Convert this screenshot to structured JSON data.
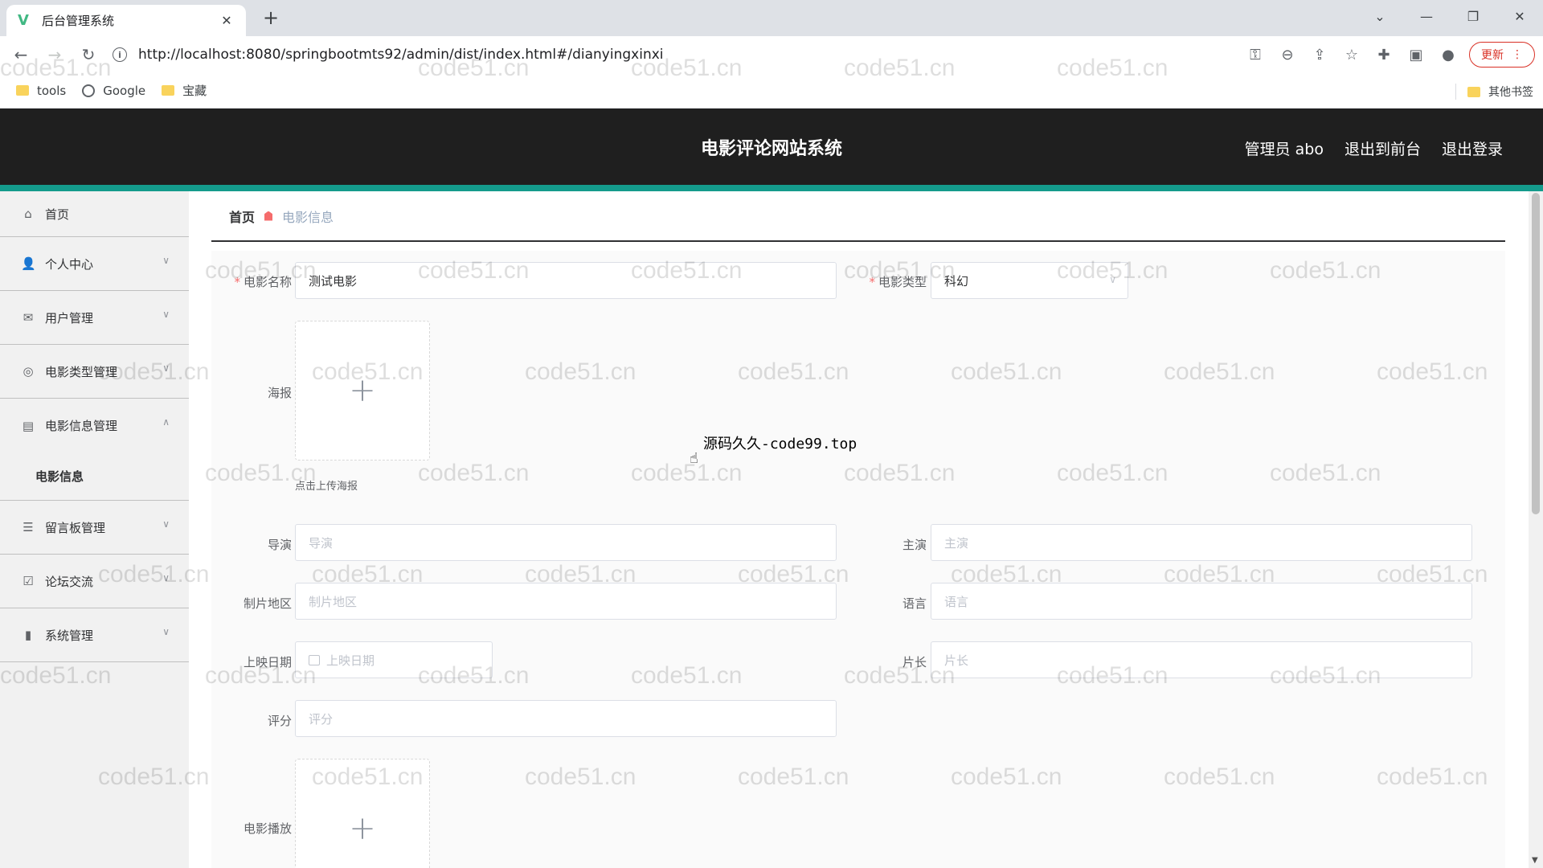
{
  "browser": {
    "tab_title": "后台管理系统",
    "tab_close": "✕",
    "new_tab": "+",
    "url": "http://localhost:8080/springbootmts92/admin/dist/index.html#/dianyingxinxi",
    "update_label": "更新",
    "bookmarks": [
      "tools",
      "Google",
      "宝藏"
    ],
    "other_bookmarks": "其他书签"
  },
  "header": {
    "title": "电影评论网站系统",
    "links": [
      "管理员 abo",
      "退出到前台",
      "退出登录"
    ]
  },
  "sidebar": {
    "items": [
      {
        "label": "首页",
        "icon": "home-icon"
      },
      {
        "label": "个人中心",
        "icon": "user-icon"
      },
      {
        "label": "用户管理",
        "icon": "mail-icon"
      },
      {
        "label": "电影类型管理",
        "icon": "target-icon"
      },
      {
        "label": "电影信息管理",
        "icon": "clipboard-icon"
      },
      {
        "label": "电影信息",
        "icon": ""
      },
      {
        "label": "留言板管理",
        "icon": "list-icon"
      },
      {
        "label": "论坛交流",
        "icon": "checkbox-icon"
      },
      {
        "label": "系统管理",
        "icon": "bar-chart-icon"
      }
    ]
  },
  "breadcrumb": {
    "home": "首页",
    "current": "电影信息"
  },
  "form": {
    "name_label": "电影名称",
    "name_value": "测试电影",
    "type_label": "电影类型",
    "type_value": "科幻",
    "poster_label": "海报",
    "poster_tip": "点击上传海报",
    "director_label": "导演",
    "director_placeholder": "导演",
    "actor_label": "主演",
    "actor_placeholder": "主演",
    "region_label": "制片地区",
    "region_placeholder": "制片地区",
    "language_label": "语言",
    "language_placeholder": "语言",
    "date_label": "上映日期",
    "date_placeholder": "上映日期",
    "duration_label": "片长",
    "duration_placeholder": "片长",
    "score_label": "评分",
    "score_placeholder": "评分",
    "play_label": "电影播放",
    "required_mark": "*",
    "plus": "+"
  },
  "overlay_text": "源码久久-code99.top",
  "watermark": "code51.cn"
}
